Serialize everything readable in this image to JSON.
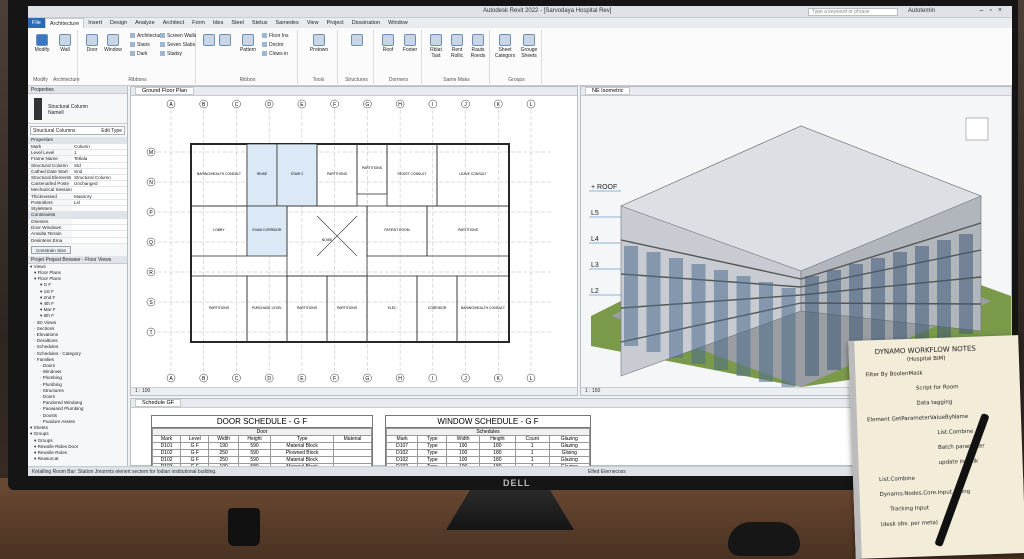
{
  "app": {
    "title": "Autodesk Revit 2022 - [Sarvodaya Hospital Rev]",
    "search_placeholder": "Type a keyword or phrase",
    "user": "Autotemin"
  },
  "menu_tabs": [
    "File",
    "Architecture",
    "Insert",
    "Design",
    "Analyze",
    "Architect",
    "Form",
    "Ides",
    "Steel",
    "Stetus",
    "Samedes",
    "View",
    "Project",
    "Dsssination",
    "Window"
  ],
  "ribbon": {
    "modify": "Modify",
    "modify_sub": "Modify",
    "wall": "Wall",
    "architecture_label": "Architecture",
    "door": "Door",
    "window": "Window",
    "architecture_small": "Architecture",
    "stairs": "Stairs",
    "screen_walls": "Screen Walls",
    "seven_slabs": "Seven Slabs",
    "dark": "Dark",
    "staitsy": "Staitsy",
    "ribbons_label": "Ribbons",
    "floor": "Floor Ins",
    "doctor": "Doctor",
    "clows": "Clows in",
    "ribboo_label": "Ribboo",
    "pattern": "Pattern",
    "protown": "Protown",
    "tools_label": "Tools",
    "structures_label": "Structures",
    "roof": "Roof",
    "footer": "Footer",
    "dormers_label": "Dormers",
    "rblat": "Rblat Taxt",
    "rent": "Rent Rollic",
    "rauts": "Rauts Roeds",
    "same_maks_label": "Same Maks",
    "sheet": "Sheet Categors",
    "groups": "Grouge Sheets",
    "groups_label": "Groups"
  },
  "properties": {
    "header": "Properties",
    "type_name": "Structural Column",
    "type_sub": "Namell",
    "selector": "Structural Columns",
    "edit_type": "Edit Type",
    "section": "Properties",
    "rows": [
      [
        "Mark",
        "Column"
      ],
      [
        "Level Level",
        "1"
      ],
      [
        "Frame Name",
        "Tetlala"
      ],
      [
        "Structural Column",
        "Std"
      ],
      [
        "Cathed Date Start",
        "Snd"
      ],
      [
        "Structural Elements",
        "Structural Column"
      ],
      [
        "Cantenarled Poste",
        "Unchanged"
      ],
      [
        "Mechanical Session",
        ""
      ],
      [
        "Thicknessed",
        "Masonry"
      ],
      [
        "Postrollers",
        "Lsl"
      ],
      [
        "Stylelstem",
        ""
      ]
    ],
    "constraints": "Constraints",
    "constraint_rows": [
      [
        "Orientes",
        ""
      ],
      [
        "Door Windows",
        ""
      ],
      [
        "Ansulta Terrain",
        ""
      ],
      [
        "Desintens Ema",
        ""
      ]
    ],
    "apply": "Constrain Size"
  },
  "browser": {
    "header": "Projet Projest Browser - Floor Views",
    "items": [
      "Views",
      "Floor Plans",
      "Floor Plans",
      "G F",
      "1st F",
      "2nd F",
      "4th F",
      "Mar F",
      "6th F",
      "3D Views",
      "Sections",
      "Elevations",
      "Deraltions",
      "Schedules",
      "Schedules - Category",
      "Families",
      "Doors",
      "Windows",
      "Plumbing",
      "Plumbing",
      "Structures",
      "Doors",
      "Pandored Windang",
      "Paowiand Plumbing",
      "Doosts",
      "Puadure Assets",
      "Sheets",
      "Groups",
      "Groups",
      "Rewolle Rides Door",
      "Rewolle Rules",
      "Reasurcat"
    ]
  },
  "views": {
    "plan_tab": "Ground Floor Plan",
    "iso_tab": "NE Isometric",
    "plan_scale": "1 : 100",
    "iso_scale": "1 : 150",
    "grid_letters": [
      "A",
      "B",
      "C",
      "D",
      "E",
      "F",
      "G",
      "H",
      "I",
      "J",
      "K",
      "L"
    ],
    "grid_rows": [
      "M",
      "N",
      "P",
      "Q",
      "R",
      "S",
      "T"
    ],
    "rooms": [
      "BARING/HEALTH CONSULT",
      "RINSE",
      "STAIR 2",
      "PARTITIONS",
      "PARTITIONS",
      "SEXIST CONSULT",
      "LEAVE CONSULT",
      "LOBBY",
      "EXAM CORRIDOR",
      "NOISE",
      "PATIENT ROOM",
      "PARTITIONS",
      "PARTITIONS",
      "PURCHASE LEVEL",
      "PARTITIONS",
      "PARTITIONS",
      "ELEC",
      "CORRIDOR"
    ],
    "levels": [
      "ROOF",
      "L5",
      "L4",
      "L3",
      "L2"
    ]
  },
  "schedules": {
    "area_tab": "Schedule GF",
    "door": {
      "title": "DOOR SCHEDULE - G F",
      "group": "Door",
      "headers": [
        "Mark",
        "Level",
        "Width",
        "Height",
        "Type",
        "Material"
      ],
      "rows": [
        [
          "D101",
          "G F",
          "190",
          "590",
          "Material Block",
          ""
        ],
        [
          "D102",
          "G F",
          "250",
          "590",
          "Plowned Block",
          ""
        ],
        [
          "D102",
          "G F",
          "250",
          "590",
          "Material Block",
          ""
        ],
        [
          "D103",
          "G F",
          "100",
          "580",
          "Material Block",
          ""
        ]
      ]
    },
    "window": {
      "title": "WINDOW SCHEDULE - G F",
      "group": "Schedules",
      "headers": [
        "Mark",
        "Type",
        "Width",
        "Height",
        "Count",
        "Glazing"
      ],
      "rows": [
        [
          "D107",
          "Type",
          "190",
          "180",
          "1",
          "Glazing"
        ],
        [
          "D102",
          "Type",
          "100",
          "180",
          "1",
          "Glising"
        ],
        [
          "D102",
          "Type",
          "100",
          "180",
          "1",
          "Glazing"
        ],
        [
          "D102",
          "Type",
          "100",
          "180",
          "1",
          "Glazing"
        ]
      ]
    }
  },
  "status": "Ketalling Room Bar: Station Jmormts elenert sectem for lodian institutional building.",
  "status_filter": "Elfed Eternecoss",
  "monitor_brand": "DELL",
  "notebook": {
    "title": "DYNAMO WORKFLOW NOTES",
    "subtitle": "(Hospital BIM)",
    "lines": [
      "Filter By BoolenMask",
      "Script for Room",
      "Data tagging",
      "Element GetParameterValueByName",
      "List.Combine",
      "Batch parameter",
      "update in bulk",
      "List.Combine",
      "Dynamo.Nodes.Core.Input.String",
      "Tracking Input",
      "(desk obs. per meta)"
    ]
  }
}
